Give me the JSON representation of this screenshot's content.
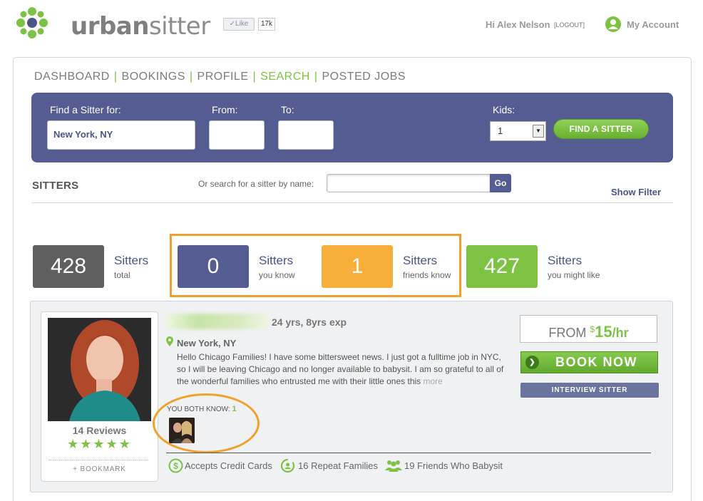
{
  "header": {
    "brand_light": "urban",
    "brand_bold": "sitter",
    "like_label": "Like",
    "like_count": "17k",
    "greeting": "Hi Alex Nelson",
    "logout_label": "[LOGOUT]",
    "account_label": "My Account"
  },
  "nav": {
    "items": [
      {
        "label": "DASHBOARD",
        "active": false
      },
      {
        "label": "BOOKINGS",
        "active": false
      },
      {
        "label": "PROFILE",
        "active": false
      },
      {
        "label": "SEARCH",
        "active": true
      },
      {
        "label": "POSTED JOBS",
        "active": false
      }
    ],
    "separator": "|"
  },
  "search": {
    "find_label": "Find a Sitter for:",
    "location_value": "New York, NY",
    "from_label": "From:",
    "from_value": "",
    "to_label": "To:",
    "to_value": "",
    "kids_label": "Kids:",
    "kids_value": "1",
    "find_button": "FIND A SITTER"
  },
  "sitters_section": {
    "heading": "SITTERS",
    "name_search_label": "Or search for a sitter by name:",
    "name_search_value": "",
    "go_label": "Go",
    "show_filter": "Show Filter"
  },
  "stats": [
    {
      "count": "428",
      "title": "Sitters",
      "sub": "total",
      "color": "#5f5f5f"
    },
    {
      "count": "0",
      "title": "Sitters",
      "sub": "you know",
      "color": "#545c92"
    },
    {
      "count": "1",
      "title": "Sitters",
      "sub": "friends know",
      "color": "#f7ae3b"
    },
    {
      "count": "427",
      "title": "Sitters",
      "sub": "you might like",
      "color": "#7dc243"
    }
  ],
  "listing": {
    "age_exp": "24 yrs, 8yrs exp",
    "location": "New York, NY",
    "bio": "Hello Chicago Families! I have some bittersweet news. I just got a fulltime job in NYC, so I will be leaving Chicago and no longer available to babysit. I am so grateful to all of the wonderful families who entrusted me with their little ones this",
    "more_label": "more",
    "both_know_label": "YOU BOTH KNOW:",
    "both_know_count": "1",
    "reviews": "14 Reviews",
    "stars": "★★★★★",
    "rating": 5,
    "bookmark": "+ BOOKMARK",
    "price_prefix": "FROM",
    "price_currency": "$",
    "price_amount": "15",
    "price_unit": "/hr",
    "book_button": "BOOK NOW",
    "interview_button": "INTERVIEW SITTER",
    "features": [
      {
        "icon": "dollar-circle-icon",
        "label": "Accepts Credit Cards"
      },
      {
        "icon": "repeat-families-icon",
        "label": "16 Repeat Families"
      },
      {
        "icon": "friends-group-icon",
        "label": "19 Friends Who Babysit"
      }
    ]
  },
  "colors": {
    "brand_green": "#7dc243",
    "brand_navy": "#545c92",
    "highlight_orange": "#f2a02a"
  }
}
